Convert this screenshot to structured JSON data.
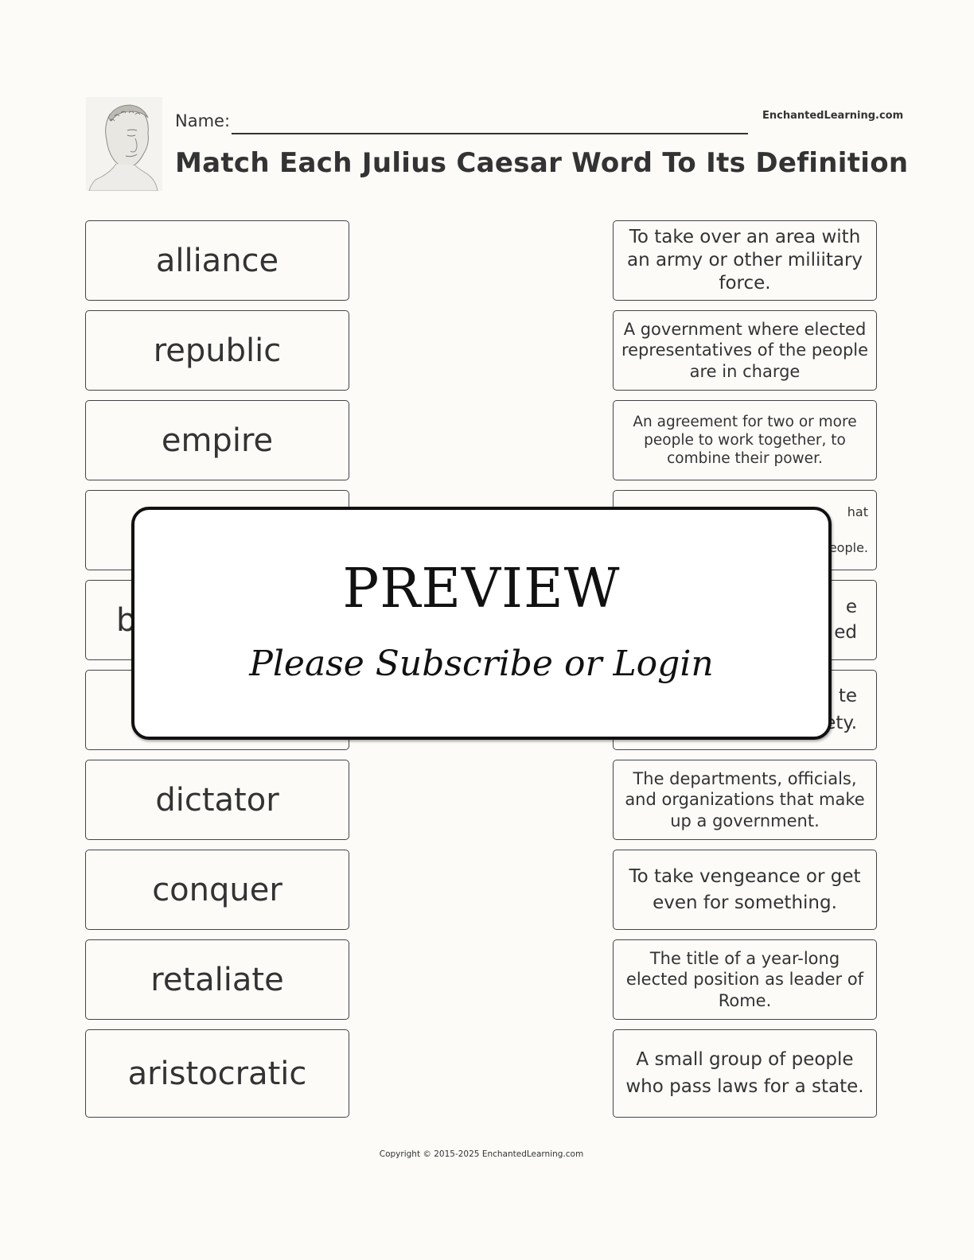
{
  "header": {
    "portrait_icon": "julius-caesar-bust-icon",
    "name_label": "Name:",
    "site_brand": "EnchantedLearning.com",
    "title": "Match Each Julius Caesar Word To Its Definition"
  },
  "words": [
    "alliance",
    "republic",
    "empire",
    "",
    "b",
    "",
    "dictator",
    "conquer",
    "retaliate",
    "aristocratic"
  ],
  "definitions": [
    "To take over an area with an army or other miliitary force.",
    "A government where elected representatives of the people are in charge",
    "An agreement for two or more people to work together, to combine their power.",
    "hat\neople.",
    "e\ned",
    "te\nety.",
    "The departments, officials, and organizations that make up a government.",
    "To take vengeance or get even for something.",
    "The title of a year-long elected position as leader of Rome.",
    "A small group of people who pass laws for a state."
  ],
  "overlay": {
    "title": "PREVIEW",
    "subtitle": "Please Subscribe or Login"
  },
  "footer": {
    "copyright": "Copyright © 2015-2025 EnchantedLearning.com"
  }
}
